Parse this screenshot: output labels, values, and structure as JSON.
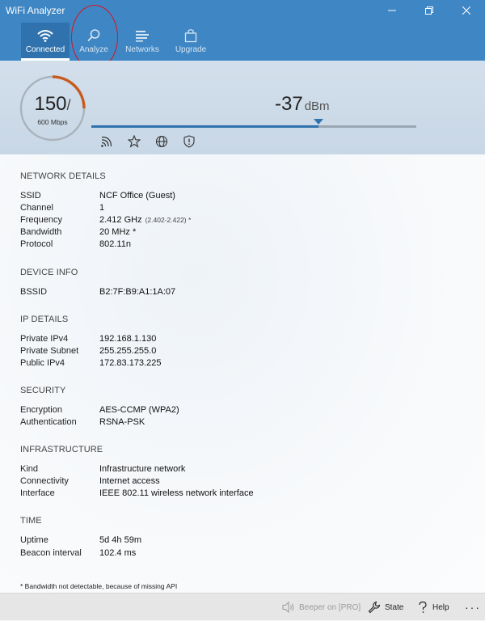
{
  "window": {
    "title": "WiFi Analyzer"
  },
  "nav": [
    {
      "label": "Connected",
      "icon": "wifi-icon",
      "active": true
    },
    {
      "label": "Analyze",
      "icon": "magnifier-icon",
      "active": false
    },
    {
      "label": "Networks",
      "icon": "list-icon",
      "active": false
    },
    {
      "label": "Upgrade",
      "icon": "shopping-bag-icon",
      "active": false
    }
  ],
  "speed": {
    "value": "150",
    "slash": "/",
    "max": "600 Mbps",
    "fill_fraction": 0.25
  },
  "signal": {
    "value": "-37",
    "unit": "dBm",
    "level_fraction": 0.7
  },
  "actions": [
    "signal-icon",
    "star-icon",
    "globe-icon",
    "shield-icon"
  ],
  "sections": {
    "network": {
      "title": "NETWORK DETAILS",
      "rows": [
        {
          "key": "SSID",
          "value": "NCF Office (Guest)"
        },
        {
          "key": "Channel",
          "value": "1"
        },
        {
          "key": "Frequency",
          "value": "2.412 GHz",
          "extra": "(2.402-2.422) *"
        },
        {
          "key": "Bandwidth",
          "value": "20 MHz *"
        },
        {
          "key": "Protocol",
          "value": "802.11n"
        }
      ]
    },
    "device": {
      "title": "DEVICE INFO",
      "rows": [
        {
          "key": "BSSID",
          "value": "B2:7F:B9:A1:1A:07"
        }
      ]
    },
    "ip": {
      "title": "IP DETAILS",
      "rows": [
        {
          "key": "Private IPv4",
          "value": "192.168.1.130"
        },
        {
          "key": "Private Subnet",
          "value": "255.255.255.0"
        },
        {
          "key": "Public IPv4",
          "value": "172.83.173.225"
        }
      ]
    },
    "security": {
      "title": "SECURITY",
      "rows": [
        {
          "key": "Encryption",
          "value": "AES-CCMP (WPA2)"
        },
        {
          "key": "Authentication",
          "value": "RSNA-PSK"
        }
      ]
    },
    "infra": {
      "title": "INFRASTRUCTURE",
      "rows": [
        {
          "key": "Kind",
          "value": "Infrastructure network"
        },
        {
          "key": "Connectivity",
          "value": "Internet access"
        },
        {
          "key": "Interface",
          "value": "IEEE 802.11 wireless network interface"
        }
      ]
    },
    "time": {
      "title": "TIME",
      "rows": [
        {
          "key": "Uptime",
          "value": "5d 4h 59m"
        },
        {
          "key": "Beacon interval",
          "value": "102.4 ms"
        }
      ]
    }
  },
  "footnote": "* Bandwidth not detectable, because of missing API",
  "bottombar": {
    "beeper": "Beeper on [PRO]",
    "state": "State",
    "help": "Help",
    "more": "···"
  },
  "colors": {
    "accent": "#3f86c4",
    "accent_dark": "#2f72ad",
    "gauge_arc": "#c85a1e",
    "annotation": "#d8141e"
  }
}
